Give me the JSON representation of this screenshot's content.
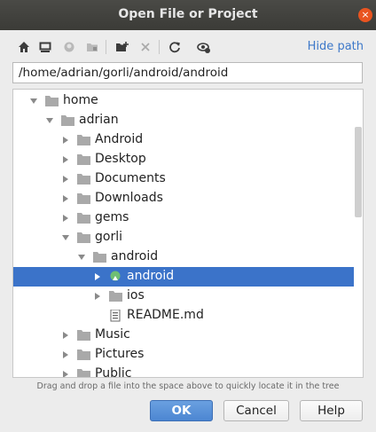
{
  "window": {
    "title": "Open File or Project",
    "close_glyph": "×"
  },
  "toolbar": {
    "icons": [
      "home-icon",
      "desktop-icon",
      "project-icon",
      "module-icon",
      "new-folder-icon",
      "delete-icon",
      "refresh-icon",
      "show-hidden-icon"
    ],
    "hide_path_label": "Hide path"
  },
  "path": {
    "value": "/home/adrian/gorli/android/android"
  },
  "tree": {
    "items": [
      {
        "label": "home",
        "expanded": true,
        "icon": "folder-icon"
      },
      {
        "label": "adrian",
        "expanded": true,
        "icon": "folder-icon"
      },
      {
        "label": "Android",
        "expanded": false,
        "icon": "folder-icon"
      },
      {
        "label": "Desktop",
        "expanded": false,
        "icon": "folder-icon"
      },
      {
        "label": "Documents",
        "expanded": false,
        "icon": "folder-icon"
      },
      {
        "label": "Downloads",
        "expanded": false,
        "icon": "folder-icon"
      },
      {
        "label": "gems",
        "expanded": false,
        "icon": "folder-icon"
      },
      {
        "label": "gorli",
        "expanded": true,
        "icon": "folder-icon"
      },
      {
        "label": "android",
        "expanded": true,
        "icon": "folder-icon"
      },
      {
        "label": "android",
        "expanded": false,
        "icon": "android-project-icon",
        "selected": true
      },
      {
        "label": "ios",
        "expanded": false,
        "icon": "folder-icon"
      },
      {
        "label": "README.md",
        "icon": "text-file-icon"
      },
      {
        "label": "Music",
        "expanded": false,
        "icon": "folder-icon"
      },
      {
        "label": "Pictures",
        "expanded": false,
        "icon": "folder-icon"
      },
      {
        "label": "Public",
        "expanded": false,
        "icon": "folder-icon"
      }
    ]
  },
  "hint": "Drag and drop a file into the space above to quickly locate it in the tree",
  "buttons": {
    "ok": "OK",
    "cancel": "Cancel",
    "help": "Help"
  },
  "colors": {
    "selection": "#3b73c9",
    "link": "#3d78c9",
    "ok_button": "#4c86d2"
  }
}
